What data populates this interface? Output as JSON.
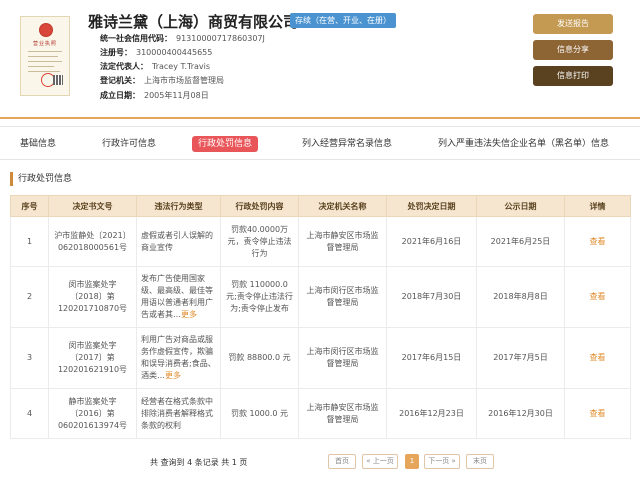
{
  "company": {
    "name": "雅诗兰黛（上海）商贸有限公司",
    "status": "存续（在营、开业、在册）",
    "credit_code_label": "统一社会信用代码：",
    "credit_code": "91310000717860307J",
    "reg_no_label": "注册号：",
    "reg_no": "310000400445655",
    "legal_rep_label": "法定代表人：",
    "legal_rep": "Tracey T.Travis",
    "authority_label": "登记机关：",
    "authority": "上海市市场监督管理局",
    "established_label": "成立日期：",
    "established": "2005年11月08日",
    "license_title": "营业执照"
  },
  "actions": {
    "report": "发送报告",
    "share": "信息分享",
    "print": "信息打印"
  },
  "tabs": [
    {
      "label": "基础信息"
    },
    {
      "label": "行政许可信息"
    },
    {
      "label": "行政处罚信息",
      "active": true
    },
    {
      "label": "列入经营异常名录信息"
    },
    {
      "label": "列入严重违法失信企业名单（黑名单）信息"
    }
  ],
  "section_title": "行政处罚信息",
  "table": {
    "headers": [
      "序号",
      "决定书文号",
      "违法行为类型",
      "行政处罚内容",
      "决定机关名称",
      "处罚决定日期",
      "公示日期",
      "详情"
    ],
    "rows": [
      {
        "no": "1",
        "doc_no": "沪市监静处〔2021〕062018000561号",
        "violation": "虚假或者引人误解的商业宣传",
        "more": "",
        "penalty": "罚款40.0000万元，责令停止违法行为",
        "authority": "上海市静安区市场监督管理局",
        "decision_date": "2021年6月16日",
        "publish_date": "2021年6月25日",
        "detail": "查看"
      },
      {
        "no": "2",
        "doc_no": "闵市监案处字〔2018〕第120201710870号",
        "violation": "发布广告使用国家级、最高级、最佳等用语以普通者利用广告或者其…",
        "more": "更多",
        "penalty": "罚款 110000.0 元;责令停止违法行为;责令停止发布",
        "authority": "上海市闵行区市场监督管理局",
        "decision_date": "2018年7月30日",
        "publish_date": "2018年8月8日",
        "detail": "查看"
      },
      {
        "no": "3",
        "doc_no": "闵市监案处字〔2017〕第120201621910号",
        "violation": "利用广告对商品或服务作虚假宣传，欺骗和误导消费者;食品、酒类…",
        "more": "更多",
        "penalty": "罚款 88800.0 元",
        "authority": "上海市闵行区市场监督管理局",
        "decision_date": "2017年6月15日",
        "publish_date": "2017年7月5日",
        "detail": "查看"
      },
      {
        "no": "4",
        "doc_no": "静市监案处字〔2016〕第060201613974号",
        "violation": "经营者在格式条款中排除消费者解释格式条款的权利",
        "more": "",
        "penalty": "罚款 1000.0 元",
        "authority": "上海市静安区市场监督管理局",
        "decision_date": "2016年12月23日",
        "publish_date": "2016年12月30日",
        "detail": "查看"
      }
    ]
  },
  "pagination": {
    "summary": "共 查询到 4 条记录 共 1 页",
    "first": "首页",
    "prev": "« 上一页",
    "current": "1",
    "next": "下一页 »",
    "last": "末页"
  }
}
